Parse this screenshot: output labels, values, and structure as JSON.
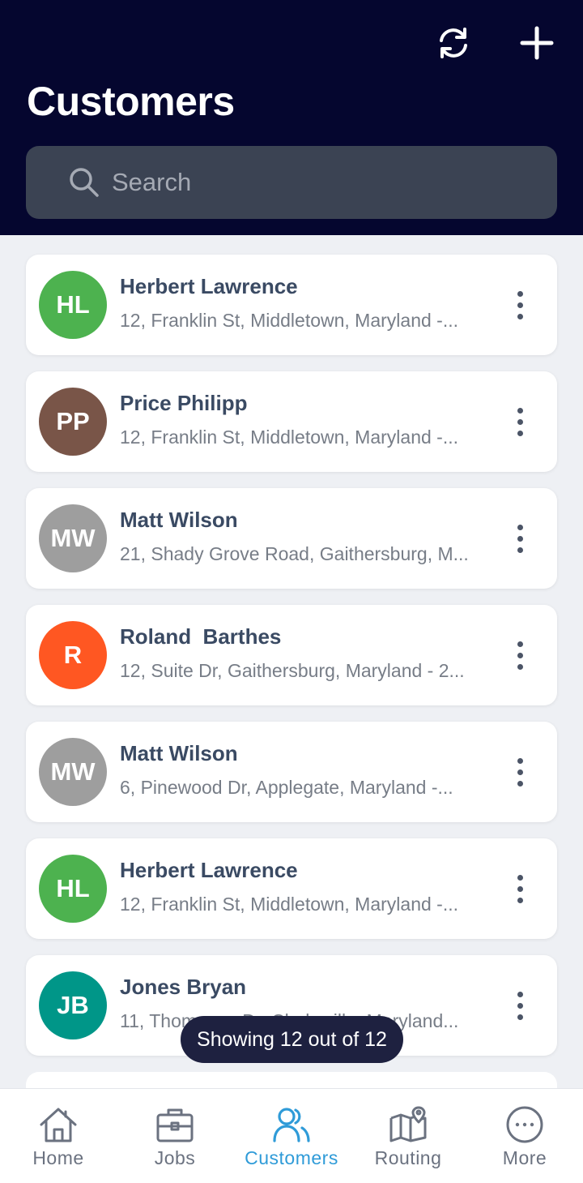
{
  "header": {
    "title": "Customers",
    "refresh_icon": "refresh-icon",
    "add_icon": "plus-icon",
    "background": "#05062f"
  },
  "search": {
    "placeholder": "Search",
    "value": ""
  },
  "customers": [
    {
      "initials": "HL",
      "name": "Herbert Lawrence",
      "address": "12, Franklin St, Middletown, Maryland -...",
      "color": "#4db24f"
    },
    {
      "initials": "PP",
      "name": "Price Philipp",
      "address": "12, Franklin St, Middletown, Maryland -...",
      "color": "#795548"
    },
    {
      "initials": "MW",
      "name": "Matt Wilson",
      "address": "21, Shady Grove Road, Gaithersburg, M...",
      "color": "#9e9e9e"
    },
    {
      "initials": "R",
      "name": "Roland  Barthes",
      "address": "12, Suite Dr, Gaithersburg, Maryland - 2...",
      "color": "#ff5722"
    },
    {
      "initials": "MW",
      "name": "Matt Wilson",
      "address": "6, Pinewood Dr, Applegate, Maryland -...",
      "color": "#9e9e9e"
    },
    {
      "initials": "HL",
      "name": "Herbert Lawrence",
      "address": "12, Franklin St, Middletown, Maryland -...",
      "color": "#4db24f"
    },
    {
      "initials": "JB",
      "name": "Jones Bryan",
      "address": "11, Thompson Dr, Clarksville, Maryland...",
      "color": "#009688"
    }
  ],
  "toast": "Showing 12 out of 12",
  "tabs": [
    {
      "label": "Home",
      "icon": "home-icon",
      "active": false
    },
    {
      "label": "Jobs",
      "icon": "briefcase-icon",
      "active": false
    },
    {
      "label": "Customers",
      "icon": "users-icon",
      "active": true
    },
    {
      "label": "Routing",
      "icon": "map-icon",
      "active": false
    },
    {
      "label": "More",
      "icon": "more-icon",
      "active": false
    }
  ],
  "colors": {
    "accent": "#2f9bd8",
    "inactive_tab": "#6b7280"
  }
}
